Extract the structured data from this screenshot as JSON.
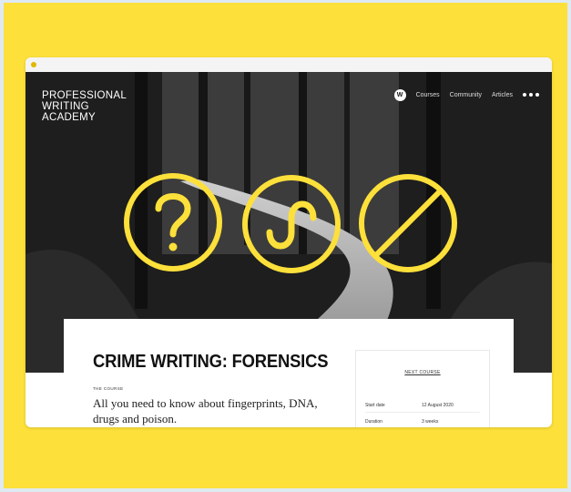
{
  "site": {
    "logo_lines": [
      "PROFESSIONAL",
      "WRITING",
      "ACADEMY"
    ]
  },
  "nav": {
    "avatar_letter": "W",
    "items": [
      "Courses",
      "Community",
      "Articles"
    ],
    "more_icon": "more-dots-icon"
  },
  "hero": {
    "symbols": [
      "question-mark-circle-icon",
      "s-curve-circle-icon",
      "prohibited-circle-icon"
    ],
    "accent_color": "#fde03a"
  },
  "course": {
    "title": "CRIME WRITING: FORENSICS",
    "eyebrow": "THE COURSE",
    "tagline": "All you need to know about fingerprints, DNA, drugs and poison."
  },
  "side_panel": {
    "heading": "NEXT COURSE",
    "rows": [
      {
        "label": "Start date",
        "value": "12 August 2020"
      },
      {
        "label": "Duration",
        "value": "3 weeks"
      }
    ]
  },
  "colors": {
    "frame_background": "#fde03a",
    "page_background": "#dfe9f1"
  }
}
